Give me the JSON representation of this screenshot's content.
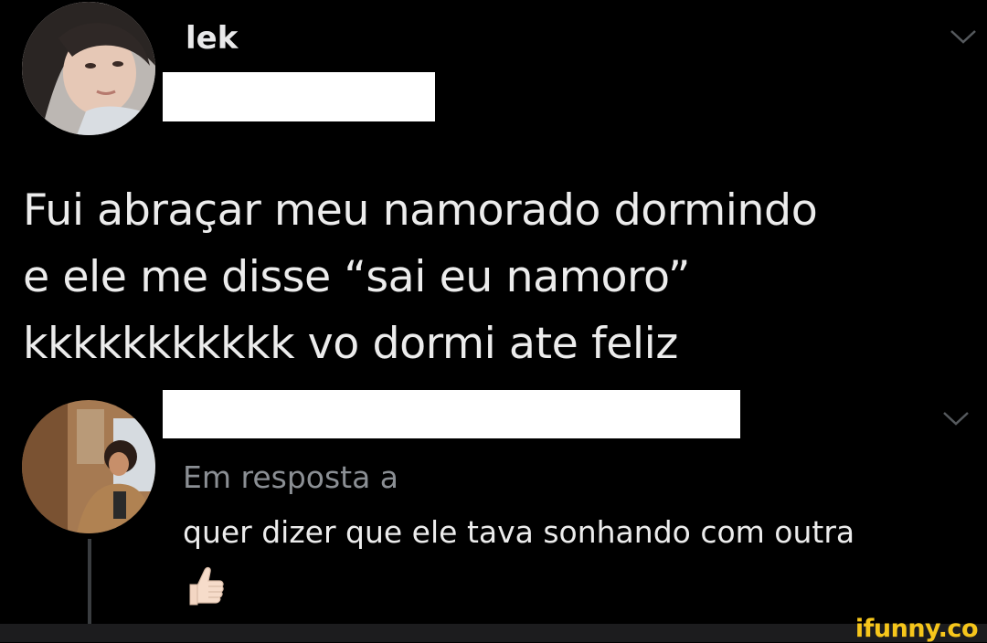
{
  "tweet": {
    "username": "lek",
    "text_lines": [
      "Fui abraçar meu namorado dormindo",
      "e ele me disse “sai eu namoro”",
      "kkkkkkkkkkk vo dormi ate feliz"
    ]
  },
  "reply": {
    "reply_label": "Em resposta a",
    "text": "quer dizer que ele tava sonhando com outra",
    "emoji": "thumbs-up-light-skin-tone"
  },
  "watermark": "ifunny.co",
  "colors": {
    "background": "#000000",
    "text": "#ececec",
    "muted": "#8b8f94",
    "watermark": "#f6c61b"
  }
}
